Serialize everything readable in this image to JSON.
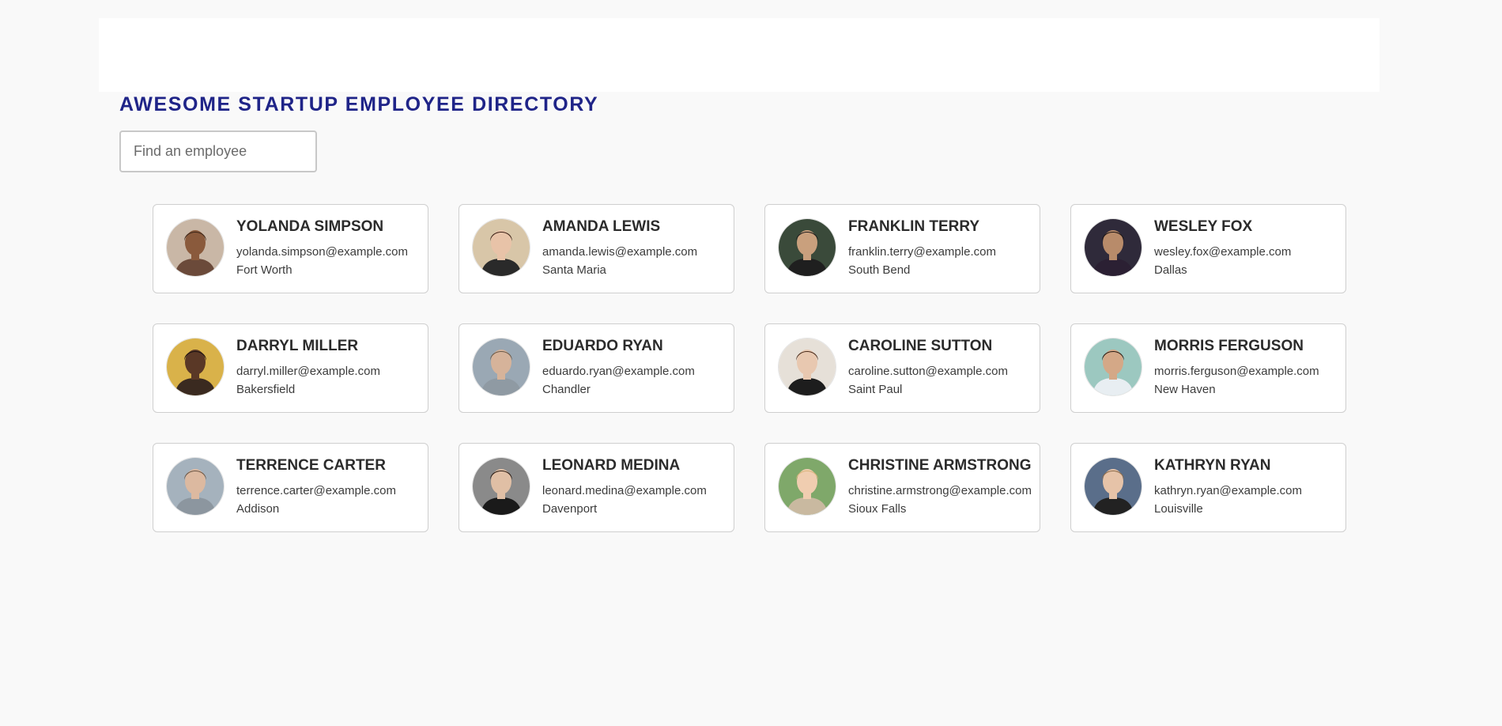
{
  "header": {
    "title": "AWESOME STARTUP EMPLOYEE DIRECTORY"
  },
  "search": {
    "placeholder": "Find an employee",
    "value": ""
  },
  "employees": [
    {
      "name": "YOLANDA SIMPSON",
      "email": "yolanda.simpson@example.com",
      "city": "Fort Worth",
      "avatar": {
        "bg": "#c9b7a6",
        "skin": "#8a5a3c",
        "hair": "#3a2518",
        "shirt": "#6b4a3a"
      }
    },
    {
      "name": "AMANDA LEWIS",
      "email": "amanda.lewis@example.com",
      "city": "Santa Maria",
      "avatar": {
        "bg": "#d8c6a8",
        "skin": "#e8c3a8",
        "hair": "#3b2116",
        "shirt": "#2a2a2a"
      }
    },
    {
      "name": "FRANKLIN TERRY",
      "email": "franklin.terry@example.com",
      "city": "South Bend",
      "avatar": {
        "bg": "#3a4a3a",
        "skin": "#c9a07d",
        "hair": "#1a1a1a",
        "shirt": "#1f1f1f"
      }
    },
    {
      "name": "WESLEY FOX",
      "email": "wesley.fox@example.com",
      "city": "Dallas",
      "avatar": {
        "bg": "#2f2a3a",
        "skin": "#b88b6a",
        "hair": "#1b1414",
        "shirt": "#2b2033"
      }
    },
    {
      "name": "DARRYL MILLER",
      "email": "darryl.miller@example.com",
      "city": "Bakersfield",
      "avatar": {
        "bg": "#d9b24a",
        "skin": "#5a3826",
        "hair": "#1a1010",
        "shirt": "#3a2a20"
      }
    },
    {
      "name": "EDUARDO RYAN",
      "email": "eduardo.ryan@example.com",
      "city": "Chandler",
      "avatar": {
        "bg": "#9aa8b4",
        "skin": "#d6b39a",
        "hair": "#6b5a48",
        "shirt": "#8f9aa3"
      }
    },
    {
      "name": "CAROLINE SUTTON",
      "email": "caroline.sutton@example.com",
      "city": "Saint Paul",
      "avatar": {
        "bg": "#e6e0d8",
        "skin": "#e8c8b0",
        "hair": "#4a2c1c",
        "shirt": "#1d1d1d"
      }
    },
    {
      "name": "MORRIS FERGUSON",
      "email": "morris.ferguson@example.com",
      "city": "New Haven",
      "avatar": {
        "bg": "#9cc8c0",
        "skin": "#d4a887",
        "hair": "#2a1c14",
        "shirt": "#e8eef2"
      }
    },
    {
      "name": "TERRENCE CARTER",
      "email": "terrence.carter@example.com",
      "city": "Addison",
      "avatar": {
        "bg": "#a5b2bd",
        "skin": "#dcb9a0",
        "hair": "#6a5544",
        "shirt": "#8c969f"
      }
    },
    {
      "name": "LEONARD MEDINA",
      "email": "leonard.medina@example.com",
      "city": "Davenport",
      "avatar": {
        "bg": "#8a8a8a",
        "skin": "#e0bfa5",
        "hair": "#2a1a12",
        "shirt": "#1a1a1a"
      }
    },
    {
      "name": "CHRISTINE ARMSTRONG",
      "email": "christine.armstrong@example.com",
      "city": "Sioux Falls",
      "avatar": {
        "bg": "#7fa86a",
        "skin": "#f0cdb0",
        "hair": "#d9b57a",
        "shirt": "#c9b9a0"
      }
    },
    {
      "name": "KATHRYN RYAN",
      "email": "kathryn.ryan@example.com",
      "city": "Louisville",
      "avatar": {
        "bg": "#5a6e8a",
        "skin": "#e6c3a8",
        "hair": "#8a6a4a",
        "shirt": "#222222"
      }
    }
  ]
}
